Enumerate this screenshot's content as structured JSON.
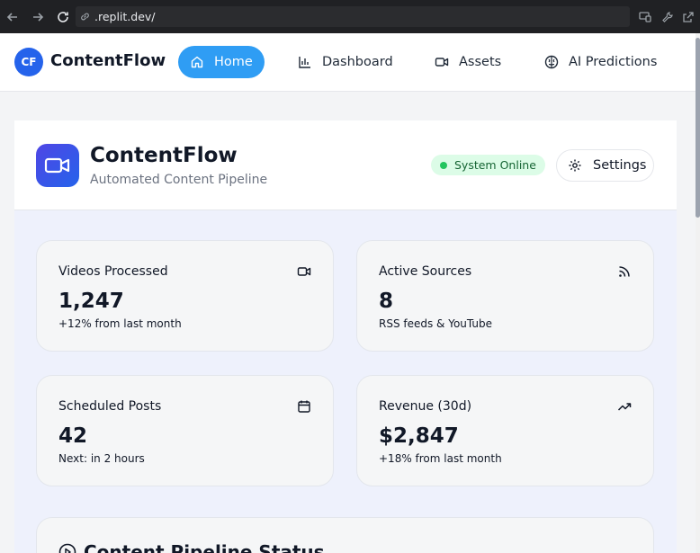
{
  "browser": {
    "url": ".replit.dev/"
  },
  "header": {
    "logo_initials": "CF",
    "brand": "ContentFlow",
    "nav": [
      {
        "label": "Home",
        "icon": "home-icon",
        "active": true
      },
      {
        "label": "Dashboard",
        "icon": "bar-chart-icon",
        "active": false
      },
      {
        "label": "Assets",
        "icon": "video-icon",
        "active": false
      },
      {
        "label": "AI Predictions",
        "icon": "brain-icon",
        "active": false
      }
    ]
  },
  "hero": {
    "title": "ContentFlow",
    "subtitle": "Automated Content Pipeline",
    "status": "System Online",
    "settings_label": "Settings"
  },
  "stats": [
    {
      "label": "Videos Processed",
      "value": "1,247",
      "sub": "+12% from last month",
      "icon": "video-icon"
    },
    {
      "label": "Active Sources",
      "value": "8",
      "sub": "RSS feeds & YouTube",
      "icon": "rss-icon"
    },
    {
      "label": "Scheduled Posts",
      "value": "42",
      "sub": "Next: in 2 hours",
      "icon": "calendar-icon"
    },
    {
      "label": "Revenue (30d)",
      "value": "$2,847",
      "sub": "+18% from last month",
      "icon": "trending-up-icon"
    }
  ],
  "pipeline": {
    "title": "Content Pipeline Status"
  },
  "colors": {
    "accent": "#2f9df4",
    "brand": "#2563eb",
    "status_bg": "#dcfce7",
    "status_dot": "#22c55e"
  }
}
